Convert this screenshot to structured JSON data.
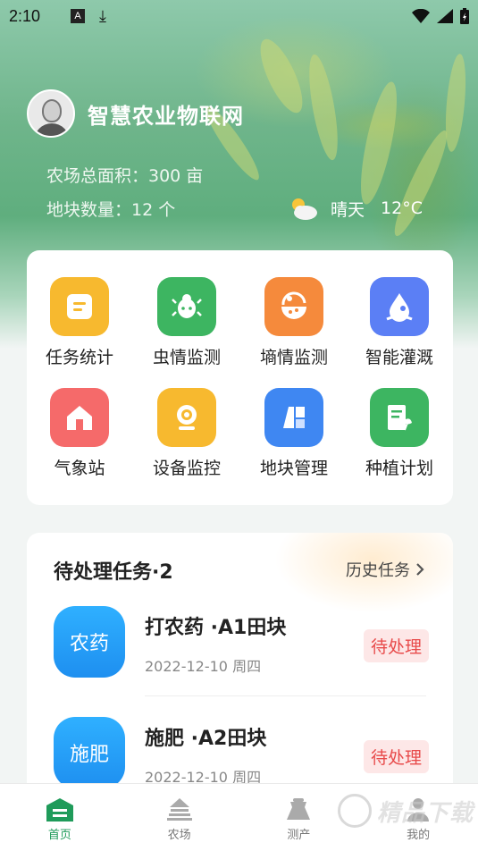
{
  "status": {
    "time": "2:10",
    "a_icon": "A"
  },
  "header": {
    "app_title": "智慧农业物联网",
    "area_label": "农场总面积：300 亩",
    "plots_label": "地块数量：12 个",
    "weather_text": "晴天",
    "temperature": "12°C"
  },
  "grid": [
    {
      "label": "任务统计",
      "icon": "task-stats-icon",
      "color": "#f7b92f"
    },
    {
      "label": "虫情监测",
      "icon": "bug-icon",
      "color": "#3db561"
    },
    {
      "label": "墒情监测",
      "icon": "soil-icon",
      "color": "#f58a3c"
    },
    {
      "label": "智能灌溉",
      "icon": "water-drop-icon",
      "color": "#5b7ff5"
    },
    {
      "label": "气象站",
      "icon": "home-icon",
      "color": "#f56a6a"
    },
    {
      "label": "设备监控",
      "icon": "camera-icon",
      "color": "#f7b92f"
    },
    {
      "label": "地块管理",
      "icon": "plot-icon",
      "color": "#3f87f2"
    },
    {
      "label": "种植计划",
      "icon": "plan-icon",
      "color": "#3db561"
    }
  ],
  "tasks": {
    "title": "待处理任务·2",
    "history_label": "历史任务",
    "items": [
      {
        "badge": "农药",
        "title": "打农药 ·A1田块",
        "date": "2022-12-10 周四",
        "status": "待处理"
      },
      {
        "badge": "施肥",
        "title": "施肥 ·A2田块",
        "date": "2022-12-10 周四",
        "status": "待处理"
      }
    ]
  },
  "tabbar": [
    {
      "label": "首页",
      "active": true
    },
    {
      "label": "农场",
      "active": false
    },
    {
      "label": "测产",
      "active": false
    },
    {
      "label": "我的",
      "active": false
    }
  ],
  "watermark": {
    "text": "精品下载"
  }
}
